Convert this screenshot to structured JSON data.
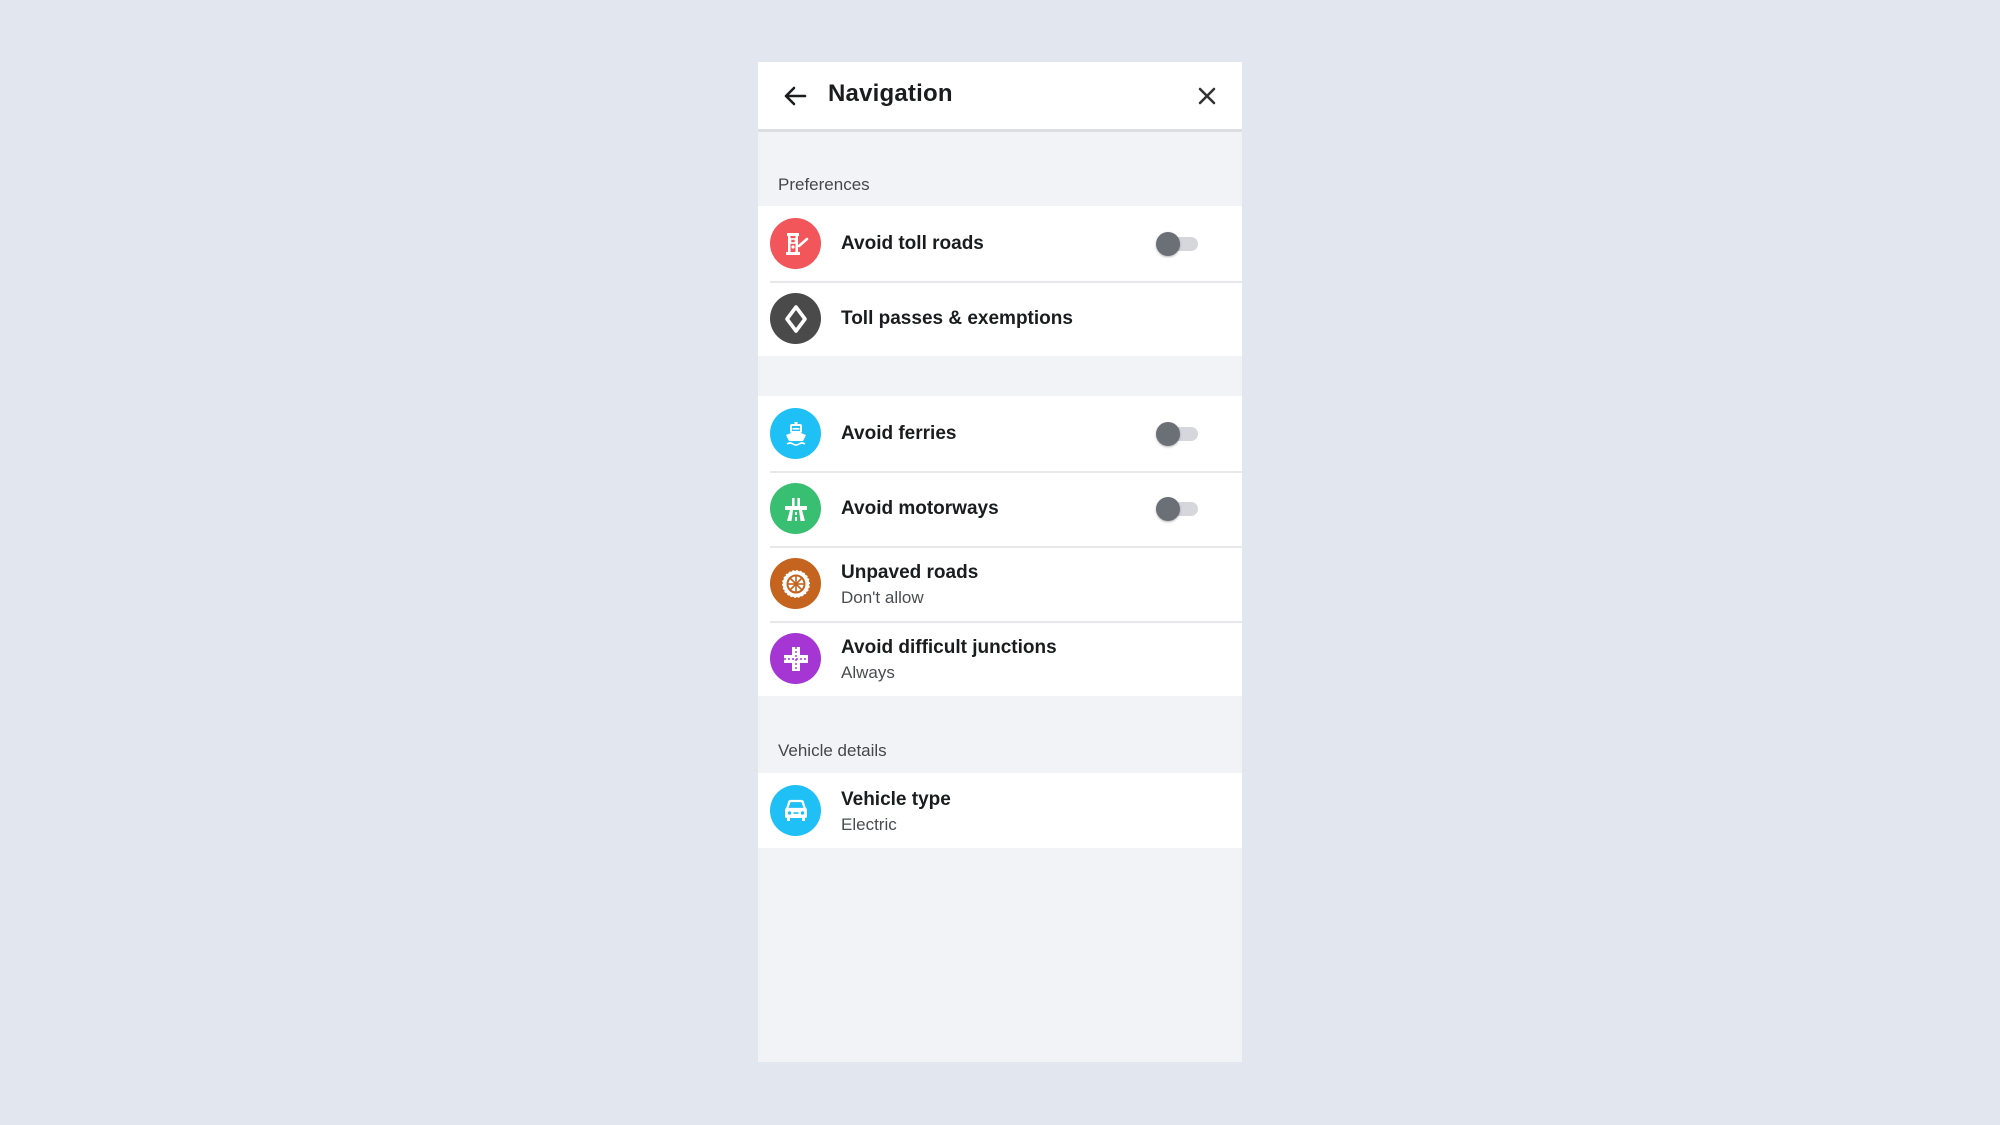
{
  "header": {
    "title": "Navigation",
    "back_icon": "arrow-left-icon",
    "close_icon": "close-icon"
  },
  "sections": {
    "preferences": {
      "label": "Preferences"
    },
    "vehicle": {
      "label": "Vehicle details"
    }
  },
  "items": {
    "toll_roads": {
      "title": "Avoid toll roads",
      "icon": "toll-booth-icon",
      "icon_color": "#f2555a",
      "toggle_on": false
    },
    "toll_passes": {
      "title": "Toll passes & exemptions",
      "icon": "diamond-icon",
      "icon_color": "#4a4a4a"
    },
    "ferries": {
      "title": "Avoid ferries",
      "icon": "ferry-icon",
      "icon_color": "#1ec0f5",
      "toggle_on": false
    },
    "motorways": {
      "title": "Avoid motorways",
      "icon": "motorway-icon",
      "icon_color": "#38bf71",
      "toggle_on": false
    },
    "unpaved": {
      "title": "Unpaved roads",
      "subtitle": "Don't allow",
      "icon": "tire-icon",
      "icon_color": "#c4641e"
    },
    "junctions": {
      "title": "Avoid difficult junctions",
      "subtitle": "Always",
      "icon": "junction-icon",
      "icon_color": "#a636d3"
    },
    "vehicle_type": {
      "title": "Vehicle type",
      "subtitle": "Electric",
      "icon": "car-icon",
      "icon_color": "#1ec0f5"
    }
  },
  "colors": {
    "page_background": "#e2e7ef",
    "panel_background": "#f1f3f7",
    "toggle_knob_off": "#6b6f76",
    "toggle_track_off": "#d5d7dc"
  }
}
